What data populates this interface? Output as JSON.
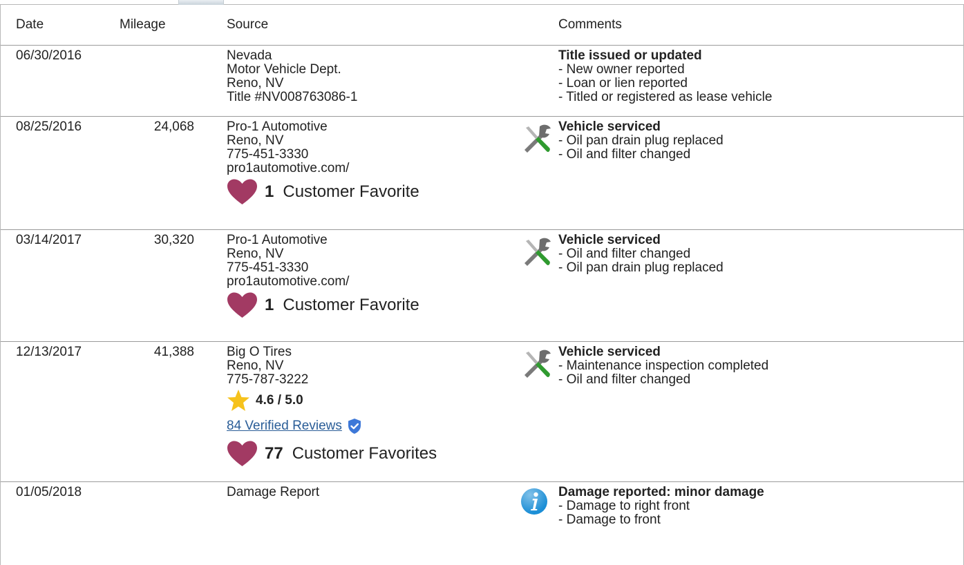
{
  "header": {
    "date": "Date",
    "mileage": "Mileage",
    "source": "Source",
    "comments": "Comments"
  },
  "rows": [
    {
      "date": "06/30/2016",
      "mileage": "",
      "source": [
        "Nevada",
        "Motor Vehicle Dept.",
        "Reno, NV",
        "Title #NV008763086-1"
      ],
      "comment_title": "Title issued or updated",
      "comment_lines": [
        "- New owner reported",
        "- Loan or lien reported",
        "- Titled or registered as lease vehicle"
      ],
      "icon": ""
    },
    {
      "date": "08/25/2016",
      "mileage": "24,068",
      "source": [
        "Pro-1 Automotive",
        "Reno, NV",
        "775-451-3330",
        "pro1automotive.com/"
      ],
      "favorites_count": "1",
      "favorites_label": "Customer Favorite",
      "comment_title": "Vehicle serviced",
      "comment_lines": [
        "- Oil pan drain plug replaced",
        "- Oil and filter changed"
      ],
      "icon": "wrench-screwdriver-icon"
    },
    {
      "date": "03/14/2017",
      "mileage": "30,320",
      "source": [
        "Pro-1 Automotive",
        "Reno, NV",
        "775-451-3330",
        "pro1automotive.com/"
      ],
      "favorites_count": "1",
      "favorites_label": "Customer Favorite",
      "comment_title": "Vehicle serviced",
      "comment_lines": [
        "- Oil and filter changed",
        "- Oil pan drain plug replaced"
      ],
      "icon": "wrench-screwdriver-icon"
    },
    {
      "date": "12/13/2017",
      "mileage": "41,388",
      "source": [
        "Big O Tires",
        "Reno, NV",
        "775-787-3222"
      ],
      "rating": "4.6 / 5.0",
      "reviews_link": "84 Verified Reviews",
      "favorites_count": "77",
      "favorites_label": "Customer Favorites",
      "comment_title": "Vehicle serviced",
      "comment_lines": [
        "- Maintenance inspection completed",
        "- Oil and filter changed"
      ],
      "icon": "wrench-screwdriver-icon"
    },
    {
      "date": "01/05/2018",
      "mileage": "",
      "source": [
        "Damage Report"
      ],
      "comment_title": "Damage reported: minor damage",
      "comment_lines": [
        "- Damage to right front",
        "- Damage to front"
      ],
      "icon": "info-icon"
    }
  ],
  "colors": {
    "heart": "#a23a63",
    "star": "#f6c21c",
    "link": "#2a5d97",
    "verified_badge": "#3d78d8",
    "info_icon": "#1b8ed6",
    "wrench": "#6d6d6d",
    "screwdriver_handle": "#2f9a2f",
    "border": "#9a9a9a"
  }
}
